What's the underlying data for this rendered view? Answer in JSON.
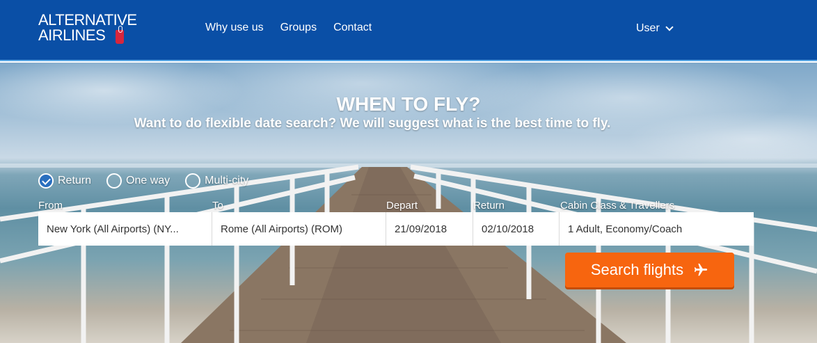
{
  "header": {
    "logo_line1": "ALTERNATIVE",
    "logo_line2": "AIRLINES",
    "nav": [
      {
        "label": "Why use us"
      },
      {
        "label": "Groups"
      },
      {
        "label": "Contact"
      }
    ],
    "user_label": "User",
    "colors": {
      "background": "#0a4fa6",
      "border": "#5aa8e6"
    }
  },
  "hero": {
    "title": "WHEN TO FLY?",
    "subtitle": "Want to do flexible date search? We will suggest what is the best time to fly."
  },
  "trip_types": {
    "options": [
      {
        "label": "Return",
        "checked": true
      },
      {
        "label": "One way",
        "checked": false
      },
      {
        "label": "Multi-city",
        "checked": false
      }
    ]
  },
  "search": {
    "labels": {
      "from": "From",
      "to": "To",
      "depart": "Depart",
      "return": "Return",
      "cabin": "Cabin Class & Travellers"
    },
    "values": {
      "from": "New York (All Airports) (NY...",
      "to": "Rome (All Airports) (ROM)",
      "depart": "21/09/2018",
      "return": "02/10/2018",
      "cabin": "1 Adult, Economy/Coach"
    },
    "button_label": "Search flights",
    "button_color": "#f7650f"
  }
}
